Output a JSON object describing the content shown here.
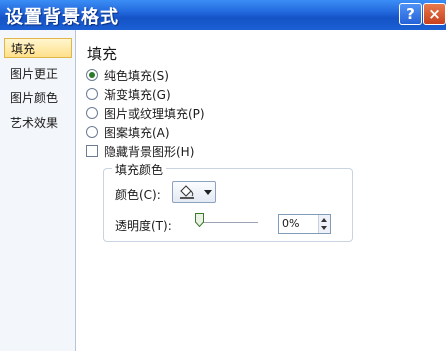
{
  "window": {
    "title": "设置背景格式",
    "help_label": "?",
    "close_label": "×"
  },
  "sidebar": {
    "items": [
      {
        "label": "填充"
      },
      {
        "label": "图片更正"
      },
      {
        "label": "图片颜色"
      },
      {
        "label": "艺术效果"
      }
    ]
  },
  "main": {
    "section_title": "填充",
    "options": [
      {
        "label": "纯色填充(S)",
        "checked": true
      },
      {
        "label": "渐变填充(G)",
        "checked": false
      },
      {
        "label": "图片或纹理填充(P)",
        "checked": false
      },
      {
        "label": "图案填充(A)",
        "checked": false
      }
    ],
    "hide_background_label": "隐藏背景图形(H)",
    "fill_color": {
      "group_title": "填充颜色",
      "color_label": "颜色(C):",
      "transparency_label": "透明度(T):",
      "transparency_value": "0%"
    }
  }
}
